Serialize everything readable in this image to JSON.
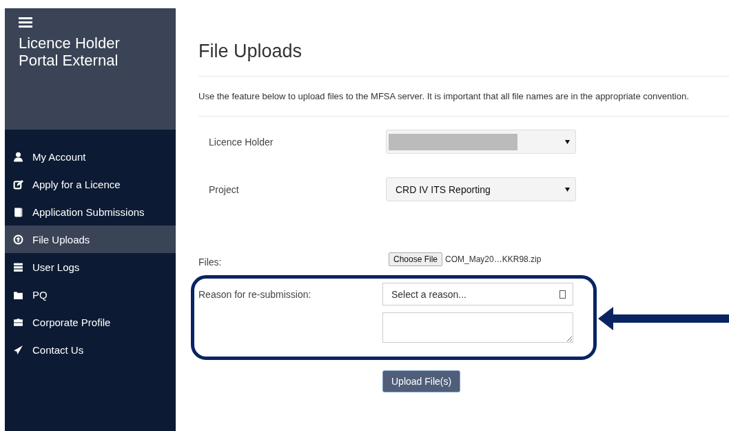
{
  "sidebar": {
    "title": "Licence Holder Portal External",
    "items": [
      {
        "label": "My Account",
        "selected": false
      },
      {
        "label": "Apply for a Licence",
        "selected": false
      },
      {
        "label": "Application Submissions",
        "selected": false
      },
      {
        "label": "File Uploads",
        "selected": true
      },
      {
        "label": "User Logs",
        "selected": false
      },
      {
        "label": "PQ",
        "selected": false
      },
      {
        "label": "Corporate Profile",
        "selected": false
      },
      {
        "label": "Contact Us",
        "selected": false
      }
    ]
  },
  "page": {
    "title": "File Uploads",
    "description": "Use the feature below to upload files to the MFSA server. It is important that all file names are in the appropriate convention."
  },
  "form": {
    "licence_holder": {
      "label": "Licence Holder"
    },
    "project": {
      "label": "Project",
      "value": "CRD IV ITS Reporting"
    },
    "files": {
      "label": "Files:",
      "button": "Choose File",
      "file_name": "COM_May20…KKR98.zip"
    },
    "reason": {
      "label": "Reason for re-submission:",
      "placeholder": "Select a reason..."
    },
    "submit": "Upload File(s)"
  }
}
